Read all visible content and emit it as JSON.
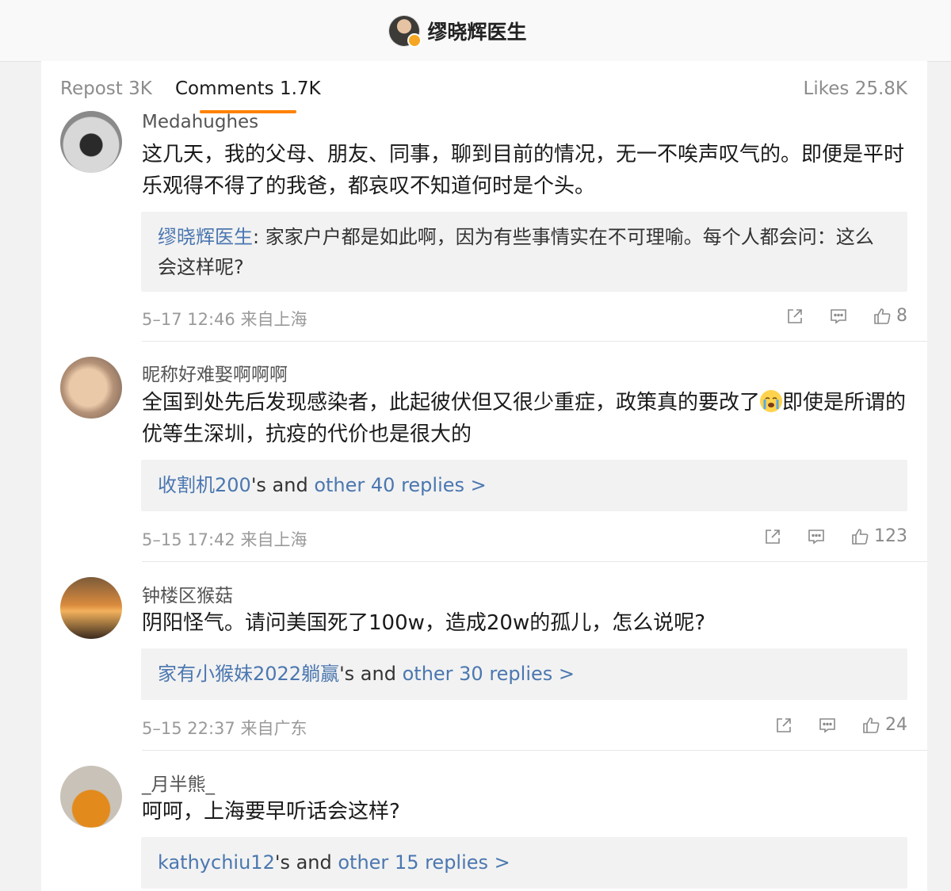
{
  "header": {
    "title": "缪晓辉医生"
  },
  "tabs": {
    "repost": "Repost 3K",
    "comments": "Comments 1.7K",
    "likes": "Likes 25.8K"
  },
  "comments": [
    {
      "username": "Medahughes",
      "text": "这几天，我的父母、朋友、同事，聊到目前的情况，无一不唉声叹气的。即便是平时乐观得不得了的我爸，都哀叹不知道何时是个头。",
      "reply_author": "缪晓辉医生",
      "reply_text": ": 家家户户都是如此啊，因为有些事情实在不可理喻。每个人都会问：这么会这样呢?",
      "meta": "5–17 12:46  来自上海",
      "likes": "8"
    },
    {
      "username": "昵称好难娶啊啊啊",
      "text_a": "全国到处先后发现感染者，此起彼伏但又很少重症，政策真的要改了",
      "emoji": "loudly-crying-face",
      "text_b": "即使是所谓的优等生深圳，抗疫的代价也是很大的",
      "reply_user": "收割机200",
      "reply_mid": "'s and ",
      "reply_more": "other 40 replies >",
      "meta": "5–15 17:42  来自上海",
      "likes": "123"
    },
    {
      "username": "钟楼区猴菇",
      "text": "阴阳怪气。请问美国死了100w，造成20w的孤儿，怎么说呢?",
      "reply_user": "家有小猴妹2022躺赢",
      "reply_mid": "'s and ",
      "reply_more": "other 30 replies >",
      "meta": "5–15 22:37  来自广东",
      "likes": "24"
    },
    {
      "username": "_月半熊_",
      "text": "呵呵，上海要早听话会这样?",
      "reply_user": "kathychiu12",
      "reply_mid": "'s and ",
      "reply_more": "other 15 replies >"
    }
  ],
  "icons": [
    "share-icon",
    "comment-icon",
    "like-icon"
  ],
  "colors": {
    "accent": "#ff8200",
    "link": "#4b77b0",
    "reply_bg": "#f2f2f2"
  }
}
